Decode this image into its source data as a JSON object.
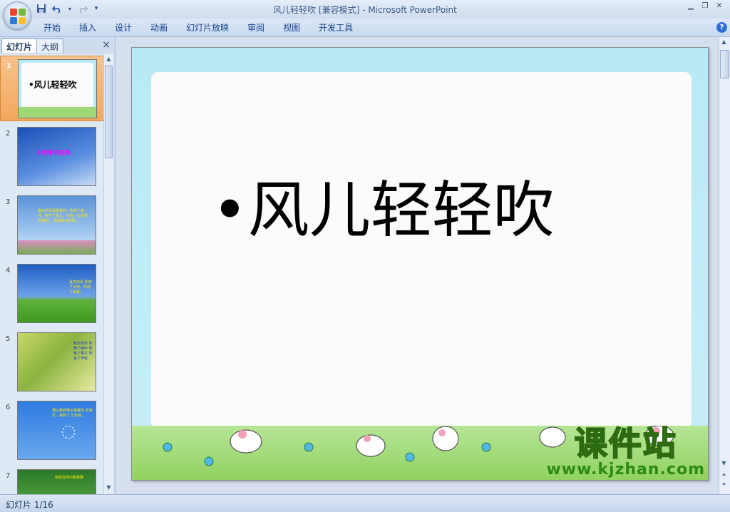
{
  "app": {
    "window_title": "风儿轻轻吹 [兼容模式]",
    "app_name": "Microsoft PowerPoint",
    "title_separator": " - "
  },
  "quick_access": {
    "save_icon": "save-icon",
    "undo_icon": "undo-icon",
    "redo_icon": "redo-icon",
    "customize_icon": "customize-icon"
  },
  "ribbon": {
    "tabs": [
      "开始",
      "插入",
      "设计",
      "动画",
      "幻灯片放映",
      "审阅",
      "视图",
      "开发工具"
    ],
    "help_label": "?"
  },
  "panel": {
    "tabs": [
      "幻灯片",
      "大纲"
    ],
    "close_label": "×"
  },
  "thumbnails": [
    {
      "number": "1",
      "text": "•风儿轻轻吹"
    },
    {
      "number": "2",
      "text": "不同季节的风"
    },
    {
      "number": "3",
      "text": "春天的风温柔柔的，吹绿了树叶，吹开了花儿，它像一位温柔的姐姐。“我是春天的风”。"
    },
    {
      "number": "4",
      "text": "夏天的风 吹落了大地，吹动了树枝。"
    },
    {
      "number": "5",
      "text": "秋天的风 吹黄了树叶 吹熟了果子 吹来了丰收"
    },
    {
      "number": "6",
      "text": "蒲公英的种子乘着风 去旅行，找到了 它的家。"
    },
    {
      "number": "7",
      "text": "荷花在风中跳着舞"
    }
  ],
  "slide": {
    "title": "•风儿轻轻吹"
  },
  "watermark": {
    "cn": "课件站",
    "url": "www.kjzhan.com"
  },
  "status": {
    "slide_indicator": "幻灯片 1/16"
  },
  "colors": {
    "accent": "#15428b",
    "selected_thumb": "#f3a75d",
    "slide_sky": "#b8e9f5",
    "slide_grass": "#8fd15f",
    "watermark_yellow": "#f5e400",
    "watermark_green": "#2d8b14"
  }
}
